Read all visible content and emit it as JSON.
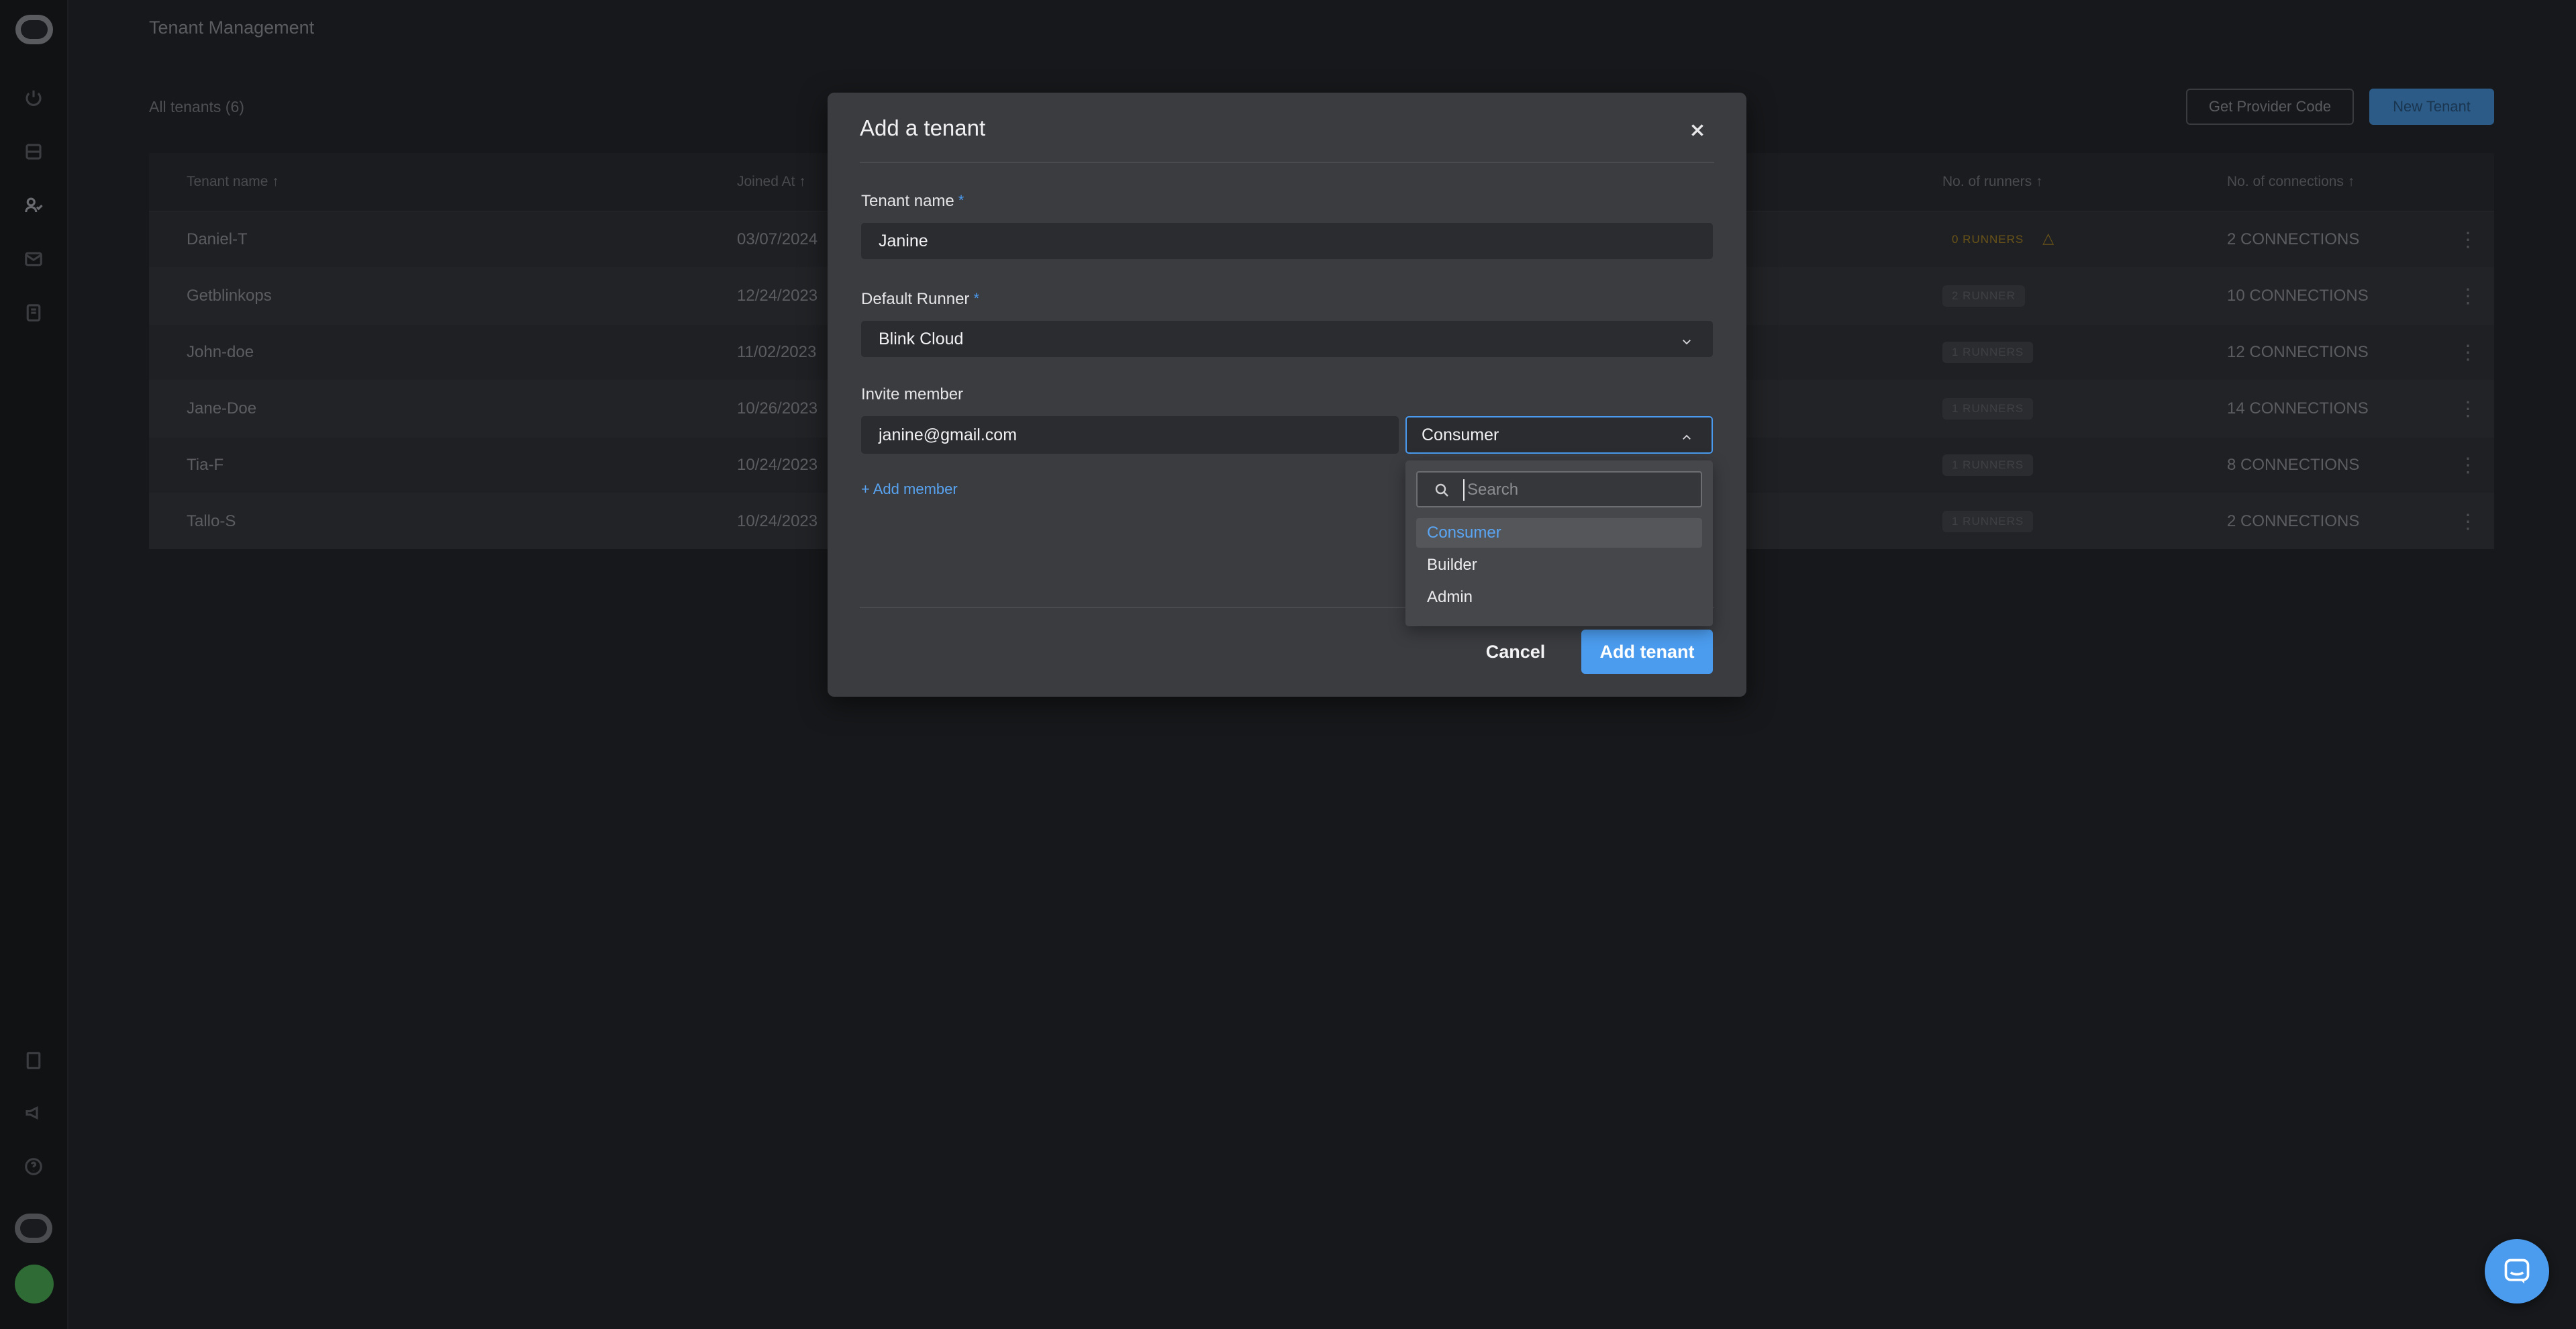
{
  "page": {
    "title": "Tenant Management",
    "tenant_count": "All tenants (6)",
    "provider_button": "Get Provider Code",
    "new_tenant_button": "New Tenant"
  },
  "table": {
    "headers": {
      "name": "Tenant name",
      "joined": "Joined At",
      "runners": "No. of runners",
      "connections": "No. of connections"
    },
    "rows": [
      {
        "name": "Daniel-T",
        "joined": "03/07/2024",
        "runners": "0 RUNNERS",
        "connections": "2 CONNECTIONS"
      },
      {
        "name": "Getblinkops",
        "joined": "12/24/2023",
        "runners": "2 RUNNER",
        "connections": "10 CONNECTIONS"
      },
      {
        "name": "John-doe",
        "joined": "11/02/2023",
        "runners": "1 RUNNERS",
        "connections": "12 CONNECTIONS"
      },
      {
        "name": "Jane-Doe",
        "joined": "10/26/2023",
        "runners": "1 RUNNERS",
        "connections": "14 CONNECTIONS"
      },
      {
        "name": "Tia-F",
        "joined": "10/24/2023",
        "runners": "1 RUNNERS",
        "connections": "8 CONNECTIONS"
      },
      {
        "name": "Tallo-S",
        "joined": "10/24/2023",
        "runners": "1 RUNNERS",
        "connections": "2 CONNECTIONS"
      }
    ]
  },
  "modal": {
    "title": "Add a tenant",
    "tenant_name_label": "Tenant name",
    "tenant_name_value": "Janine",
    "runner_label": "Default Runner",
    "runner_value": "Blink Cloud",
    "invite_label": "Invite member",
    "email_value": "janine@gmail.com",
    "role_value": "Consumer",
    "add_member": "+ Add member",
    "required_mark": "*",
    "cancel": "Cancel",
    "submit": "Add tenant"
  },
  "dropdown": {
    "search_placeholder": "Search",
    "options": [
      "Consumer",
      "Builder",
      "Admin"
    ],
    "selected": "Consumer"
  },
  "colors": {
    "accent": "#4b9cef",
    "modal_bg": "#3b3c40",
    "page_bg": "#17181b"
  },
  "icons": {
    "close": "close-icon",
    "chevron": "chevron-down-icon",
    "search": "search-icon",
    "chat": "chat-icon",
    "warning": "warning-icon"
  }
}
